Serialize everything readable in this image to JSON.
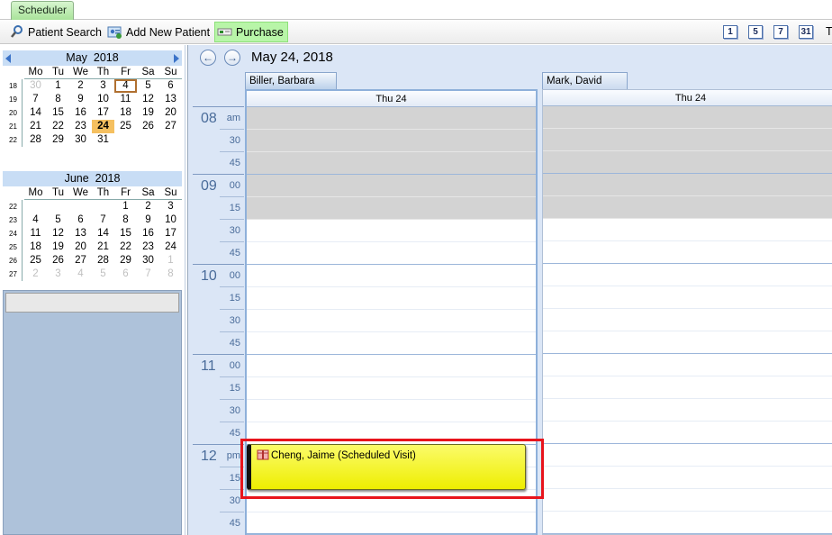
{
  "tabs": [
    {
      "label": "Scheduler"
    }
  ],
  "toolbar": {
    "patient_search": "Patient Search",
    "add_new_patient": "Add New Patient",
    "purchase": "Purchase",
    "view_buttons": [
      "1",
      "5",
      "7",
      "31"
    ],
    "trailing_char": "T"
  },
  "mini_calendars": [
    {
      "month": "May",
      "year": "2018",
      "dow": [
        "Mo",
        "Tu",
        "We",
        "Th",
        "Fr",
        "Sa",
        "Su"
      ],
      "weeks": [
        {
          "wk": "18",
          "days": [
            "30",
            "1",
            "2",
            "3",
            "4",
            "5",
            "6"
          ]
        },
        {
          "wk": "19",
          "days": [
            "7",
            "8",
            "9",
            "10",
            "11",
            "12",
            "13"
          ]
        },
        {
          "wk": "20",
          "days": [
            "14",
            "15",
            "16",
            "17",
            "18",
            "19",
            "20"
          ]
        },
        {
          "wk": "21",
          "days": [
            "21",
            "22",
            "23",
            "24",
            "25",
            "26",
            "27"
          ]
        },
        {
          "wk": "22",
          "days": [
            "28",
            "29",
            "30",
            "31",
            "",
            "",
            ""
          ]
        }
      ]
    },
    {
      "month": "June",
      "year": "2018",
      "dow": [
        "Mo",
        "Tu",
        "We",
        "Th",
        "Fr",
        "Sa",
        "Su"
      ],
      "weeks": [
        {
          "wk": "22",
          "days": [
            "",
            "",
            "",
            "",
            "1",
            "2",
            "3"
          ]
        },
        {
          "wk": "23",
          "days": [
            "4",
            "5",
            "6",
            "7",
            "8",
            "9",
            "10"
          ]
        },
        {
          "wk": "24",
          "days": [
            "11",
            "12",
            "13",
            "14",
            "15",
            "16",
            "17"
          ]
        },
        {
          "wk": "25",
          "days": [
            "18",
            "19",
            "20",
            "21",
            "22",
            "23",
            "24"
          ]
        },
        {
          "wk": "26",
          "days": [
            "25",
            "26",
            "27",
            "28",
            "29",
            "30",
            "1"
          ]
        },
        {
          "wk": "27",
          "days": [
            "2",
            "3",
            "4",
            "5",
            "6",
            "7",
            "8"
          ]
        }
      ]
    }
  ],
  "scheduler": {
    "date_title": "May 24, 2018",
    "hours": [
      {
        "hour": "08",
        "slots": [
          "am",
          "30",
          "45"
        ]
      },
      {
        "hour": "09",
        "slots": [
          "00",
          "15",
          "30",
          "45"
        ]
      },
      {
        "hour": "10",
        "slots": [
          "00",
          "15",
          "30",
          "45"
        ]
      },
      {
        "hour": "11",
        "slots": [
          "00",
          "15",
          "30",
          "45"
        ]
      },
      {
        "hour": "12",
        "slots": [
          "pm",
          "15",
          "30",
          "45"
        ]
      }
    ],
    "resources": [
      {
        "name": "Biller, Barbara",
        "day": "Thu 24"
      },
      {
        "name": "Mark, David",
        "day": "Thu 24"
      }
    ],
    "appointment": {
      "label": "Cheng, Jaime (Scheduled Visit)"
    }
  },
  "colors": {
    "appointment": "#eeee00",
    "highlight": "#e8141c",
    "today_fill": "#f5c060",
    "busy_slot": "#d3d3d3"
  }
}
